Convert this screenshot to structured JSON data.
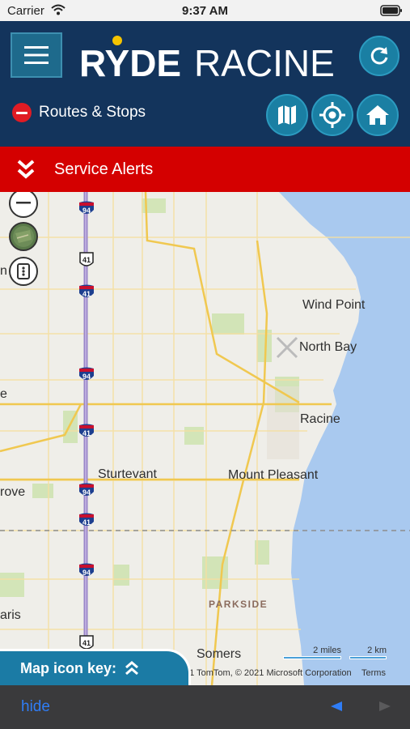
{
  "status_bar": {
    "carrier": "Carrier",
    "time": "9:37 AM"
  },
  "header": {
    "logo_text_1": "RYDE",
    "logo_text_2": "RACINE",
    "routes_label": "Routes & Stops",
    "brand_color": "#13345c",
    "accent_color": "#1a7fa3"
  },
  "alerts": {
    "label": "Service Alerts",
    "color": "#d40000"
  },
  "map": {
    "places": [
      "Wind Point",
      "North Bay",
      "Racine",
      "Sturtevant",
      "Mount Pleasant",
      "rove",
      "aris",
      "Somers",
      "PARKSIDE",
      "e",
      "n"
    ],
    "shields": [
      "94",
      "41",
      "41",
      "94",
      "41",
      "94",
      "41",
      "94",
      "41"
    ],
    "scale_miles": "2 miles",
    "scale_km": "2 km",
    "copyright": "21 TomTom, © 2021 Microsoft Corporation",
    "terms": "Terms",
    "key_label": "Map icon key:"
  },
  "toolbar": {
    "hide_label": "hide"
  }
}
